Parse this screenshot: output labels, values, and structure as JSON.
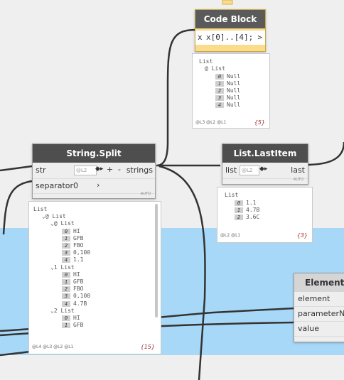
{
  "code_block": {
    "title": "Code Block",
    "port_in": "x",
    "code": "x[0]..[4];",
    "port_out": ">",
    "preview": {
      "header": "List",
      "sub": "@ List",
      "items": [
        {
          "i": "0",
          "v": "Null"
        },
        {
          "i": "1",
          "v": "Null"
        },
        {
          "i": "2",
          "v": "Null"
        },
        {
          "i": "3",
          "v": "Null"
        },
        {
          "i": "4",
          "v": "Null"
        }
      ],
      "levels": "@L3 @L2 @L1",
      "count": "{5}"
    }
  },
  "string_split": {
    "title": "String.Split",
    "in_str": "str",
    "in_sep": "separator0",
    "level": "@L2",
    "plus": "+",
    "minus": "-",
    "out": "strings",
    "auto": "AUTO",
    "preview": {
      "lines": [
        {
          "t": "List"
        },
        {
          "t": "⌄@ List"
        },
        {
          "t": "⌄@ List"
        },
        {
          "i": "0",
          "v": "HI"
        },
        {
          "i": "1",
          "v": "GFB"
        },
        {
          "i": "2",
          "v": "FBO"
        },
        {
          "i": "3",
          "v": "0,100"
        },
        {
          "i": "4",
          "v": "1.1"
        },
        {
          "t": "⌄1 List"
        },
        {
          "i": "0",
          "v": "HI"
        },
        {
          "i": "1",
          "v": "GFB"
        },
        {
          "i": "2",
          "v": "FBO"
        },
        {
          "i": "3",
          "v": "0,100"
        },
        {
          "i": "4",
          "v": "4.7B"
        },
        {
          "t": "⌄2 List"
        },
        {
          "i": "0",
          "v": "HI"
        },
        {
          "i": "1",
          "v": "GFB"
        }
      ],
      "levels": "@L4 @L3 @L2 @L1",
      "count": "{15}"
    }
  },
  "list_last": {
    "title": "List.LastItem",
    "in": "list",
    "level": "@L2",
    "out": "last",
    "auto": "AUTO",
    "preview": {
      "header": "List",
      "items": [
        {
          "i": "0",
          "v": "1.1"
        },
        {
          "i": "1",
          "v": "4.7B"
        },
        {
          "i": "2",
          "v": "3.6C"
        }
      ],
      "levels": "@L2 @L1",
      "count": "{3}"
    }
  },
  "element_node": {
    "title": "Element.",
    "ports": [
      "element",
      "parameterNam",
      "value"
    ]
  },
  "colors": {
    "group": "#a8d8f8",
    "code_block_body": "#fbdc8c",
    "wire": "#333333"
  }
}
